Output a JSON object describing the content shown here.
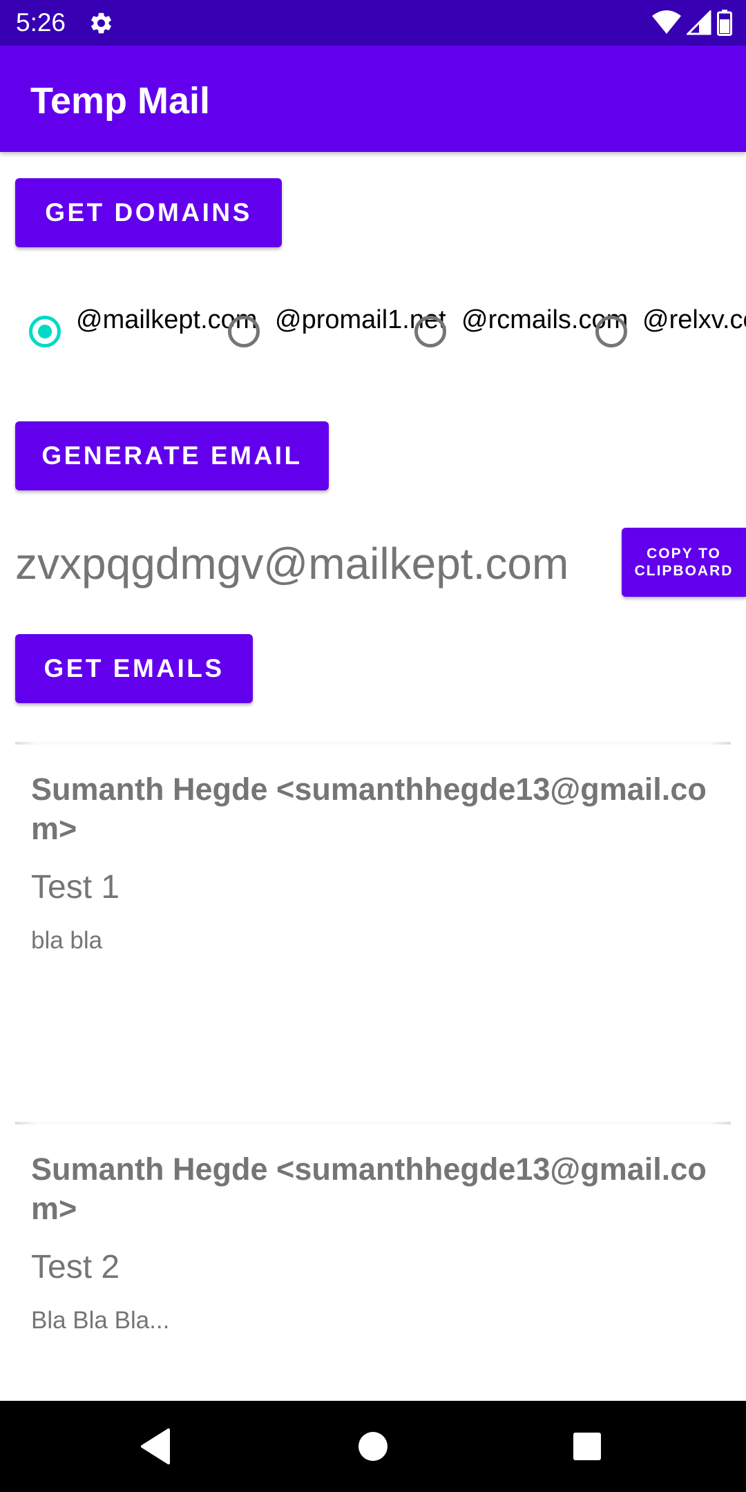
{
  "status_bar": {
    "time": "5:26",
    "icons": [
      "gear-icon",
      "wifi-icon",
      "signal-icon",
      "battery-icon"
    ]
  },
  "app_bar": {
    "title": "Temp Mail"
  },
  "buttons": {
    "get_domains": "GET DOMAINS",
    "generate_email": "GENERATE EMAIL",
    "get_emails": "GET EMAILS",
    "copy_line1": "COPY TO",
    "copy_line2": "CLIPBOARD"
  },
  "domains": [
    {
      "label": "@mailkept.com",
      "checked": true
    },
    {
      "label": "@promail1.net",
      "checked": false
    },
    {
      "label": "@rcmails.com",
      "checked": false
    },
    {
      "label": "@relxv.com",
      "checked": false
    }
  ],
  "generated_email": "zvxpqgdmgv@mailkept.com",
  "emails": [
    {
      "from": "Sumanth Hegde <sumanthhegde13@gmail.com>",
      "subject": "Test 1",
      "body": "bla bla"
    },
    {
      "from": "Sumanth Hegde <sumanthhegde13@gmail.com>",
      "subject": "Test 2",
      "body": "Bla Bla Bla..."
    }
  ],
  "colors": {
    "primary": "#6200ee",
    "primary_dark": "#3700b3",
    "accent": "#03dac5",
    "secondary_text": "#757575"
  },
  "nav_bar": {
    "icons": [
      "back-icon",
      "home-icon",
      "recents-icon"
    ]
  }
}
